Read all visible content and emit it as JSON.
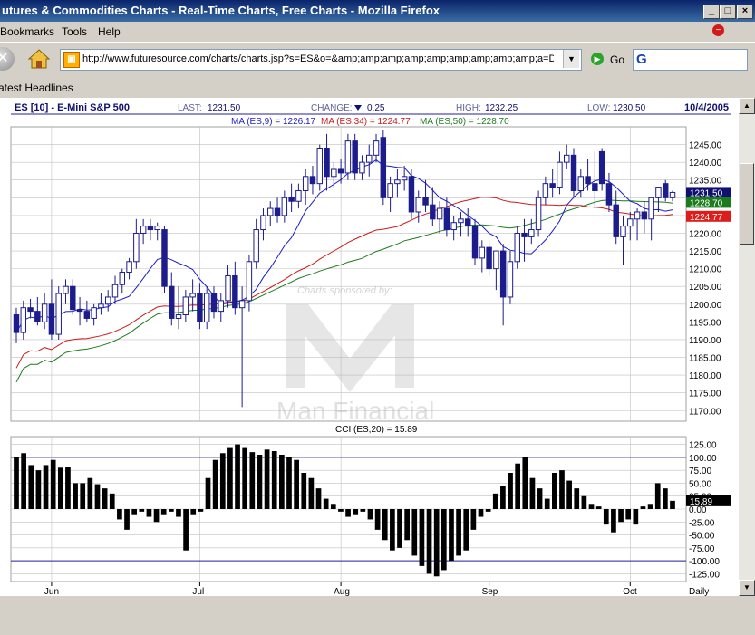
{
  "window": {
    "title": "utures & Commodities Charts - Real-Time Charts, Free Charts - Mozilla Firefox",
    "controls": [
      "_",
      "□",
      "×"
    ]
  },
  "menu": [
    "Bookmarks",
    "Tools",
    "Help"
  ],
  "nav": {
    "url": "http://www.futuresource.com/charts/charts.jsp?s=ES&o=&amp;amp;amp;amp;amp;amp;amp;amp;amp;a=D&",
    "go_label": "Go",
    "search_engine_glyph": "G",
    "stop_glyph": "✕",
    "dropdown_glyph": "▼"
  },
  "bookmarks": {
    "item": "atest Headlines"
  },
  "chart": {
    "symbol": "ES [10] - E-Mini S&P 500",
    "last_label": "LAST:",
    "last_value": "1231.50",
    "change_label": "CHANGE:",
    "change_value": "0.25",
    "high_label": "HIGH:",
    "high_value": "1232.25",
    "low_label": "LOW:",
    "low_value": "1230.50",
    "date": "10/4/2005",
    "ma9_label": "MA (ES,9) = 1226.17",
    "ma34_label": "MA (ES,34) = 1224.77",
    "ma50_label": "MA (ES,50) = 1228.70",
    "cci_label": "CCI (ES,20) = 15.89",
    "watermark_sponsor": "Charts sponsored by:",
    "watermark_brand": "Man Financial",
    "periodicity": "Daily",
    "colors": {
      "bar": "#1c1c8c",
      "ma9": "#1c1cc8",
      "ma34": "#cc1c1c",
      "ma50": "#1c7c1c",
      "grid": "#c0c0c0",
      "frame": "#2020a0"
    }
  },
  "chart_data": [
    {
      "type": "candlestick",
      "title": "ES [10] - E-Mini S&P 500",
      "ylim": [
        1167,
        1250
      ],
      "ticks": [
        "1245.00",
        "1240.00",
        "1235.00",
        "1230.00",
        "1225.00",
        "1220.00",
        "1215.00",
        "1210.00",
        "1205.00",
        "1200.00",
        "1195.00",
        "1190.00",
        "1185.00",
        "1180.00",
        "1175.00",
        "1170.00"
      ],
      "tick_values": [
        1245,
        1240,
        1235,
        1230,
        1225,
        1220,
        1215,
        1210,
        1205,
        1200,
        1195,
        1190,
        1185,
        1180,
        1175,
        1170
      ],
      "months": [
        {
          "label": "Jun",
          "index": 5
        },
        {
          "label": "Jul",
          "index": 26
        },
        {
          "label": "Aug",
          "index": 46
        },
        {
          "label": "Sep",
          "index": 67
        },
        {
          "label": "Oct",
          "index": 87
        }
      ],
      "price_tags": [
        {
          "label": "1231.50",
          "value": 1231.5,
          "color": "#101070"
        },
        {
          "label": "1228.70",
          "value": 1228.7,
          "color": "#1c7c1c"
        },
        {
          "label": "1224.77",
          "value": 1224.77,
          "color": "#dd1c1c"
        }
      ],
      "ohlc": [
        [
          1197.0,
          1199.0,
          1189.0,
          1192.0
        ],
        [
          1192.0,
          1201.0,
          1190.0,
          1199.0
        ],
        [
          1199.0,
          1201.5,
          1196.0,
          1198.0
        ],
        [
          1198.0,
          1202.0,
          1194.0,
          1195.0
        ],
        [
          1195.0,
          1203.0,
          1193.0,
          1200.0
        ],
        [
          1200.0,
          1207.0,
          1190.0,
          1191.5
        ],
        [
          1191.5,
          1205.0,
          1190.0,
          1203.0
        ],
        [
          1203.0,
          1207.0,
          1200.0,
          1205.0
        ],
        [
          1205.0,
          1207.0,
          1197.0,
          1198.5
        ],
        [
          1198.5,
          1202.0,
          1194.0,
          1198.0
        ],
        [
          1198.0,
          1201.0,
          1195.0,
          1196.0
        ],
        [
          1196.0,
          1200.0,
          1194.0,
          1199.0
        ],
        [
          1199.0,
          1203.0,
          1197.0,
          1200.0
        ],
        [
          1200.0,
          1204.0,
          1198.0,
          1202.0
        ],
        [
          1202.0,
          1208.0,
          1200.0,
          1205.5
        ],
        [
          1205.5,
          1210.0,
          1203.0,
          1209.0
        ],
        [
          1209.0,
          1213.0,
          1207.0,
          1212.0
        ],
        [
          1212.0,
          1224.0,
          1210.0,
          1220.0
        ],
        [
          1220.0,
          1224.0,
          1217.0,
          1222.0
        ],
        [
          1222.0,
          1224.0,
          1218.0,
          1221.0
        ],
        [
          1221.0,
          1223.0,
          1218.0,
          1222.0
        ],
        [
          1221.0,
          1222.0,
          1203.0,
          1205.0
        ],
        [
          1205.0,
          1209.0,
          1194.0,
          1196.0
        ],
        [
          1196.0,
          1205.0,
          1193.0,
          1197.0
        ],
        [
          1197.0,
          1204.0,
          1195.0,
          1202.0
        ],
        [
          1202.0,
          1207.0,
          1198.0,
          1203.0
        ],
        [
          1203.0,
          1206.0,
          1193.0,
          1195.0
        ],
        [
          1195.0,
          1205.0,
          1193.0,
          1203.0
        ],
        [
          1203.0,
          1205.0,
          1196.0,
          1198.0
        ],
        [
          1198.0,
          1203.0,
          1195.0,
          1201.0
        ],
        [
          1201.0,
          1211.0,
          1199.0,
          1208.0
        ],
        [
          1208.0,
          1212.0,
          1197.0,
          1199.0
        ],
        [
          1199.0,
          1205.0,
          1171.0,
          1201.0
        ],
        [
          1201.0,
          1214.0,
          1198.0,
          1212.0
        ],
        [
          1212.0,
          1224.0,
          1210.0,
          1221.0
        ],
        [
          1221.0,
          1227.0,
          1218.0,
          1225.0
        ],
        [
          1225.0,
          1229.0,
          1222.0,
          1227.0
        ],
        [
          1227.0,
          1230.0,
          1223.0,
          1225.0
        ],
        [
          1225.0,
          1232.0,
          1223.0,
          1230.0
        ],
        [
          1230.0,
          1234.0,
          1226.0,
          1229.0
        ],
        [
          1229.0,
          1234.0,
          1227.0,
          1232.0
        ],
        [
          1232.0,
          1238.0,
          1228.0,
          1236.0
        ],
        [
          1236.0,
          1239.0,
          1231.0,
          1234.0
        ],
        [
          1234.0,
          1245.0,
          1232.0,
          1244.0
        ],
        [
          1244.0,
          1248.0,
          1232.0,
          1236.0
        ],
        [
          1236.0,
          1240.0,
          1233.0,
          1238.0
        ],
        [
          1238.0,
          1241.0,
          1234.0,
          1237.0
        ],
        [
          1237.0,
          1248.0,
          1235.0,
          1246.0
        ],
        [
          1246.0,
          1248.0,
          1235.0,
          1237.0
        ],
        [
          1237.0,
          1242.0,
          1235.0,
          1240.0
        ],
        [
          1240.0,
          1245.0,
          1236.0,
          1242.0
        ],
        [
          1242.0,
          1248.0,
          1240.0,
          1246.0
        ],
        [
          1247.0,
          1249.0,
          1228.0,
          1230.0
        ],
        [
          1230.0,
          1236.0,
          1226.0,
          1234.0
        ],
        [
          1234.0,
          1238.0,
          1230.0,
          1235.0
        ],
        [
          1235.0,
          1239.0,
          1232.0,
          1236.0
        ],
        [
          1236.0,
          1238.0,
          1224.0,
          1226.0
        ],
        [
          1226.0,
          1232.0,
          1223.0,
          1230.0
        ],
        [
          1230.0,
          1235.0,
          1226.0,
          1228.0
        ],
        [
          1228.0,
          1233.0,
          1222.0,
          1224.0
        ],
        [
          1224.0,
          1229.0,
          1220.0,
          1227.0
        ],
        [
          1227.0,
          1230.0,
          1219.0,
          1221.0
        ],
        [
          1221.0,
          1225.0,
          1218.0,
          1223.0
        ],
        [
          1223.0,
          1226.0,
          1219.0,
          1224.0
        ],
        [
          1224.0,
          1227.0,
          1219.0,
          1222.0
        ],
        [
          1222.0,
          1224.0,
          1211.0,
          1213.0
        ],
        [
          1213.0,
          1218.0,
          1209.0,
          1216.0
        ],
        [
          1216.0,
          1218.0,
          1208.0,
          1210.0
        ],
        [
          1210.0,
          1214.0,
          1204.0,
          1215.0
        ],
        [
          1215.0,
          1217.0,
          1194.0,
          1202.0
        ],
        [
          1202.0,
          1215.0,
          1200.0,
          1212.0
        ],
        [
          1212.0,
          1222.0,
          1210.0,
          1220.0
        ],
        [
          1220.0,
          1224.0,
          1212.0,
          1219.0
        ],
        [
          1219.0,
          1224.0,
          1217.0,
          1221.0
        ],
        [
          1221.0,
          1232.0,
          1219.0,
          1230.0
        ],
        [
          1230.0,
          1236.0,
          1228.0,
          1234.0
        ],
        [
          1234.0,
          1238.0,
          1230.0,
          1233.0
        ],
        [
          1233.0,
          1243.0,
          1231.0,
          1240.0
        ],
        [
          1240.0,
          1245.0,
          1238.0,
          1242.0
        ],
        [
          1242.0,
          1244.0,
          1230.0,
          1232.0
        ],
        [
          1232.0,
          1238.0,
          1230.0,
          1236.0
        ],
        [
          1236.0,
          1241.0,
          1232.0,
          1234.0
        ],
        [
          1234.0,
          1243.0,
          1227.0,
          1232.0
        ],
        [
          1243.0,
          1244.0,
          1232.0,
          1234.0
        ],
        [
          1234.0,
          1237.0,
          1226.0,
          1228.0
        ],
        [
          1228.0,
          1232.0,
          1217.0,
          1219.0
        ],
        [
          1219.0,
          1225.0,
          1211.0,
          1222.0
        ],
        [
          1222.0,
          1226.0,
          1218.0,
          1224.0
        ],
        [
          1224.0,
          1227.0,
          1218.0,
          1226.0
        ],
        [
          1226.0,
          1229.0,
          1220.0,
          1224.0
        ],
        [
          1224.0,
          1228.0,
          1218.0,
          1230.0
        ],
        [
          1230.0,
          1233.0,
          1226.0,
          1233.0
        ],
        [
          1234.0,
          1235.0,
          1229.0,
          1230.0
        ],
        [
          1230.0,
          1232.0,
          1229.0,
          1231.5
        ]
      ]
    },
    {
      "type": "bar",
      "title": "CCI (ES,20) = 15.89",
      "ylim": [
        -140,
        140
      ],
      "ticks": [
        "125.00",
        "100.00",
        "75.00",
        "50.00",
        "25.00",
        "0.00",
        "-25.00",
        "-50.00",
        "-75.00",
        "-100.00",
        "-125.00"
      ],
      "tick_values": [
        125,
        100,
        75,
        50,
        25,
        0,
        -25,
        -50,
        -75,
        -100,
        -125
      ],
      "reference_lines": [
        100,
        -100
      ],
      "current_label": "15.89",
      "values": [
        100,
        108,
        85,
        75,
        85,
        95,
        80,
        82,
        50,
        50,
        60,
        48,
        40,
        30,
        -20,
        -40,
        -10,
        -5,
        -15,
        -25,
        -10,
        -5,
        -15,
        -80,
        -10,
        -5,
        60,
        95,
        108,
        118,
        125,
        118,
        110,
        105,
        115,
        112,
        105,
        100,
        95,
        70,
        60,
        40,
        20,
        10,
        -5,
        -15,
        -10,
        -5,
        -20,
        -40,
        -60,
        -80,
        -75,
        -60,
        -90,
        -110,
        -125,
        -130,
        -118,
        -100,
        -90,
        -80,
        -40,
        -15,
        -5,
        30,
        45,
        70,
        88,
        100,
        60,
        40,
        20,
        70,
        75,
        55,
        40,
        25,
        10,
        5,
        -30,
        -45,
        -25,
        -20,
        -30,
        5,
        10,
        50,
        40,
        16
      ]
    }
  ]
}
